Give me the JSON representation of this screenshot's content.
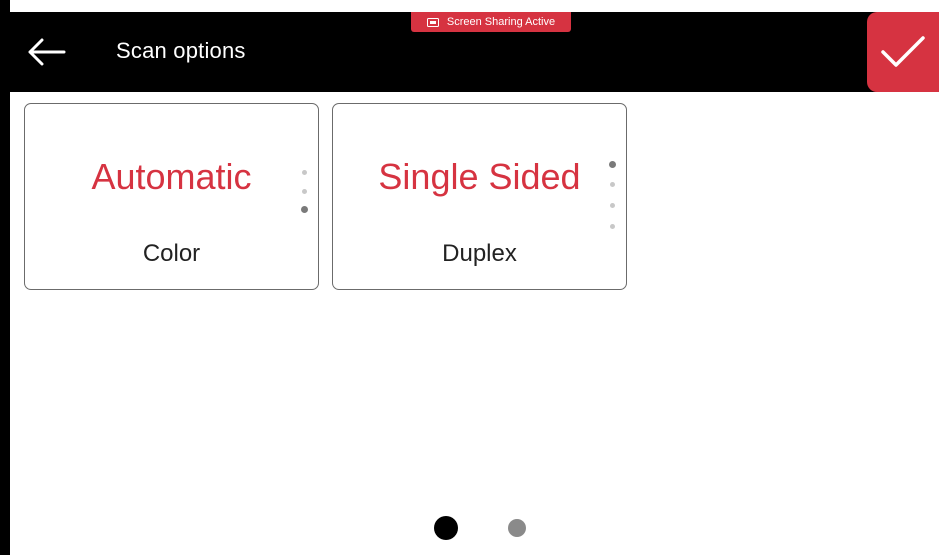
{
  "header": {
    "title": "Scan options",
    "back_icon": "arrow-left-icon",
    "confirm_icon": "checkmark-icon"
  },
  "banner": {
    "text": "Screen Sharing Active",
    "icon": "screen-share-icon"
  },
  "cards": [
    {
      "value": "Automatic",
      "label": "Color",
      "option_count": 3,
      "selected_option": 3
    },
    {
      "value": "Single Sided",
      "label": "Duplex",
      "option_count": 4,
      "selected_option": 1
    }
  ],
  "pagination": {
    "total_pages": 2,
    "current_page": 1
  },
  "colors": {
    "accent": "#d63341",
    "header_bg": "#000000",
    "background": "#ffffff",
    "text": "#222222"
  }
}
